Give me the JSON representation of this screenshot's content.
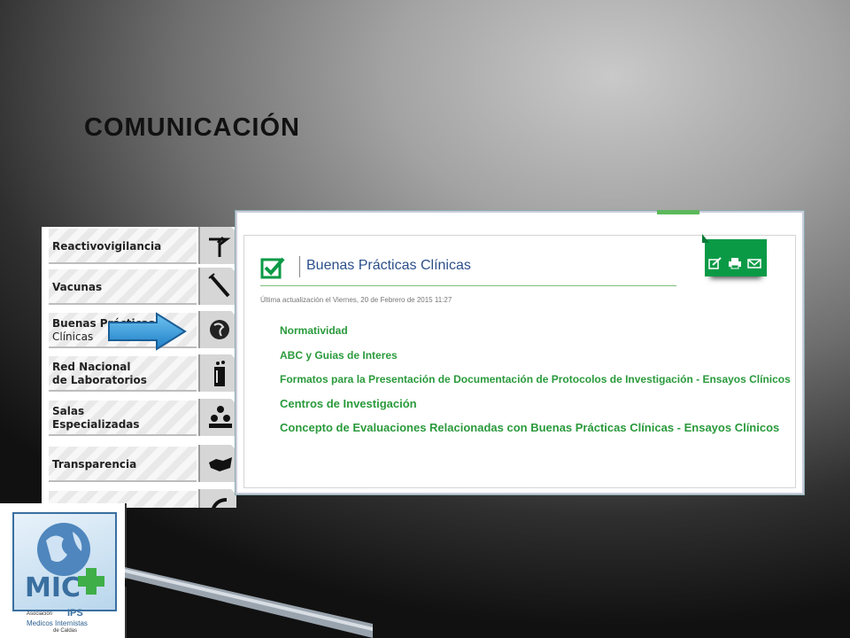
{
  "slide": {
    "title": "COMUNICACIÓN"
  },
  "menu": {
    "items": [
      {
        "line1": "Reactivovigilancia",
        "line2": "",
        "icon": "dropper-stand-icon"
      },
      {
        "line1": "Vacunas",
        "line2": "",
        "icon": "syringe-icon"
      },
      {
        "line1": "Buenas Prácticas",
        "line2": "Clínicas",
        "icon": "globe-icon"
      },
      {
        "line1": "Red Nacional",
        "line2": "de Laboratorios",
        "icon": "beaker-icon"
      },
      {
        "line1": "Salas",
        "line2": "Especializadas",
        "icon": "people-icon"
      },
      {
        "line1": "Transparencia",
        "line2": "",
        "icon": "map-icon"
      }
    ]
  },
  "page": {
    "heading": "Buenas Prácticas Clínicas",
    "updated": "Última actualización el Viernes, 20 de Febrero de 2015 11:27",
    "links": [
      "Normatividad",
      "ABC y Guias de Interes",
      "Formatos para la Presentación de Documentación de Protocolos de Investigación - Ensayos Clínicos",
      "Centros de Investigación",
      "Concepto de Evaluaciones Relacionadas con Buenas Prácticas Clínicas - Ensayos Clínicos"
    ],
    "toolbar": [
      "edit-icon",
      "print-icon",
      "email-icon"
    ]
  },
  "logo": {
    "mark": "MIC",
    "line_a": "Asociación",
    "line_b": "IPS",
    "line_c": "Medicos Internistas",
    "line_d": "de Caldas"
  },
  "colors": {
    "accent_green": "#0a9a46",
    "link_green": "#2a9a3c",
    "heading_blue": "#2b4f8a"
  }
}
